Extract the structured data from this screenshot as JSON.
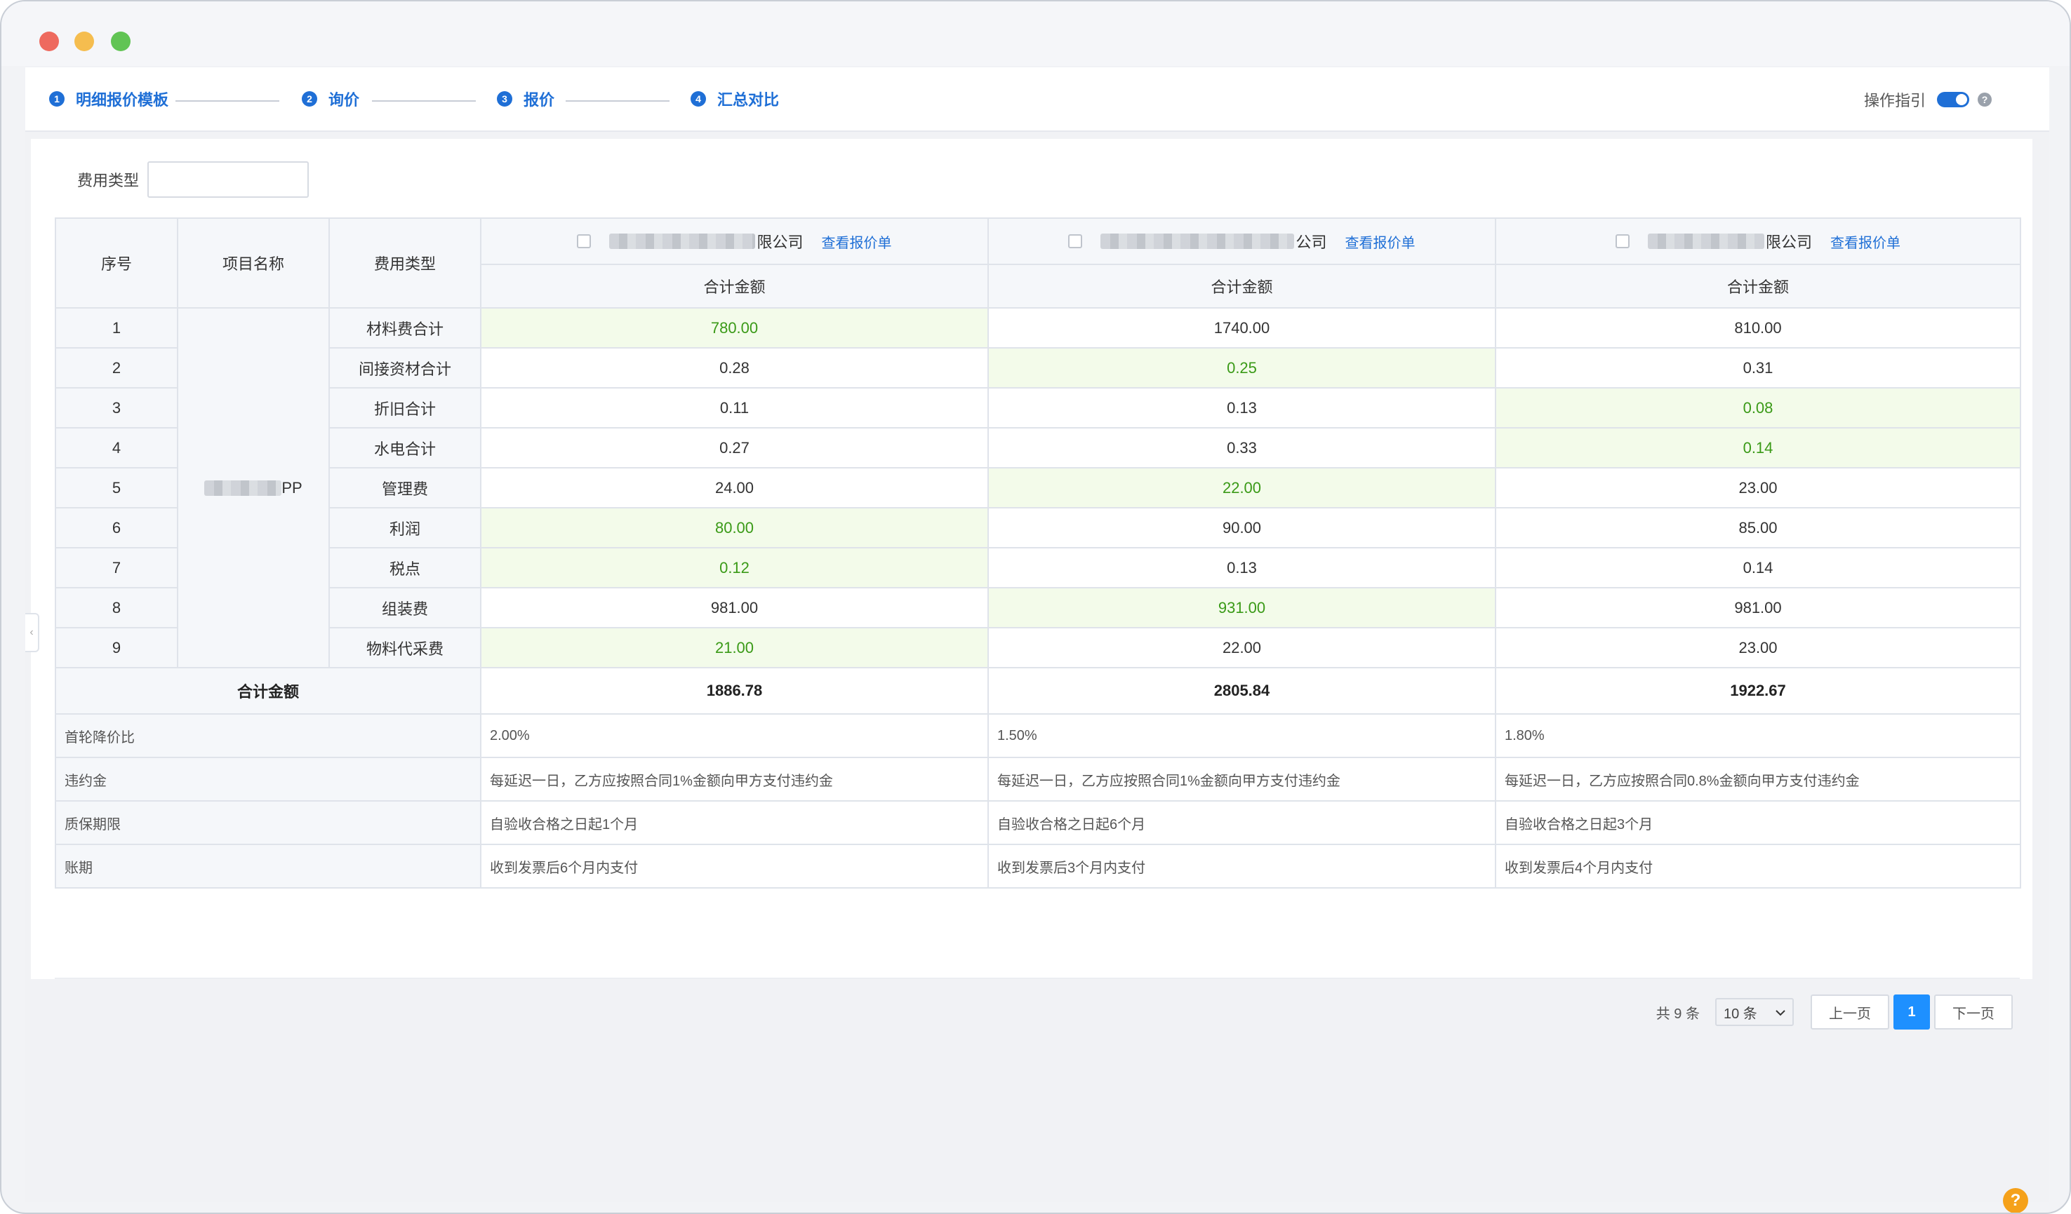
{
  "steps": [
    {
      "num": "1",
      "label": "明细报价模板"
    },
    {
      "num": "2",
      "label": "询价"
    },
    {
      "num": "3",
      "label": "报价"
    },
    {
      "num": "4",
      "label": "汇总对比"
    }
  ],
  "guide": {
    "label": "操作指引",
    "toggle_on": true,
    "help": "?"
  },
  "filter": {
    "label": "费用类型",
    "value": ""
  },
  "table": {
    "headers": {
      "index": "序号",
      "project": "项目名称",
      "fee_type": "费用类型",
      "amount": "合计金额"
    },
    "suppliers": [
      {
        "name_visible": "限公司",
        "view_link": "查看报价单"
      },
      {
        "name_visible": "公司",
        "view_link": "查看报价单"
      },
      {
        "name_visible": "限公司",
        "view_link": "查看报价单"
      }
    ],
    "project_name_visible": "PP",
    "rows": [
      {
        "idx": "1",
        "fee": "材料费合计",
        "values": [
          "780.00",
          "1740.00",
          "810.00"
        ],
        "lowest": 0
      },
      {
        "idx": "2",
        "fee": "间接资材合计",
        "values": [
          "0.28",
          "0.25",
          "0.31"
        ],
        "lowest": 1
      },
      {
        "idx": "3",
        "fee": "折旧合计",
        "values": [
          "0.11",
          "0.13",
          "0.08"
        ],
        "lowest": 2
      },
      {
        "idx": "4",
        "fee": "水电合计",
        "values": [
          "0.27",
          "0.33",
          "0.14"
        ],
        "lowest": 2
      },
      {
        "idx": "5",
        "fee": "管理费",
        "values": [
          "24.00",
          "22.00",
          "23.00"
        ],
        "lowest": 1
      },
      {
        "idx": "6",
        "fee": "利润",
        "values": [
          "80.00",
          "90.00",
          "85.00"
        ],
        "lowest": 0
      },
      {
        "idx": "7",
        "fee": "税点",
        "values": [
          "0.12",
          "0.13",
          "0.14"
        ],
        "lowest": 0
      },
      {
        "idx": "8",
        "fee": "组装费",
        "values": [
          "981.00",
          "931.00",
          "981.00"
        ],
        "lowest": 1
      },
      {
        "idx": "9",
        "fee": "物料代采费",
        "values": [
          "21.00",
          "22.00",
          "23.00"
        ],
        "lowest": 0
      }
    ],
    "total": {
      "label": "合计金额",
      "values": [
        "1886.78",
        "2805.84",
        "1922.67"
      ]
    },
    "info_rows": [
      {
        "label": "首轮降价比",
        "values": [
          "2.00%",
          "1.50%",
          "1.80%"
        ]
      },
      {
        "label": "违约金",
        "values": [
          "每延迟一日，乙方应按照合同1%金额向甲方支付违约金",
          "每延迟一日，乙方应按照合同1%金额向甲方支付违约金",
          "每延迟一日，乙方应按照合同0.8%金额向甲方支付违约金"
        ]
      },
      {
        "label": "质保期限",
        "values": [
          "自验收合格之日起1个月",
          "自验收合格之日起6个月",
          "自验收合格之日起3个月"
        ]
      },
      {
        "label": "账期",
        "values": [
          "收到发票后6个月内支付",
          "收到发票后3个月内支付",
          "收到发票后4个月内支付"
        ]
      }
    ]
  },
  "pagination": {
    "total": "共 9 条",
    "page_size": "10 条",
    "prev": "上一页",
    "current": "1",
    "next": "下一页"
  },
  "colors": {
    "accent": "#1f6fd6",
    "lowest_text": "#3a9a17",
    "lowest_bg": "#f3fbea",
    "page_active": "#1e90ff",
    "help_button": "#f5a11a"
  },
  "float_help": "?"
}
